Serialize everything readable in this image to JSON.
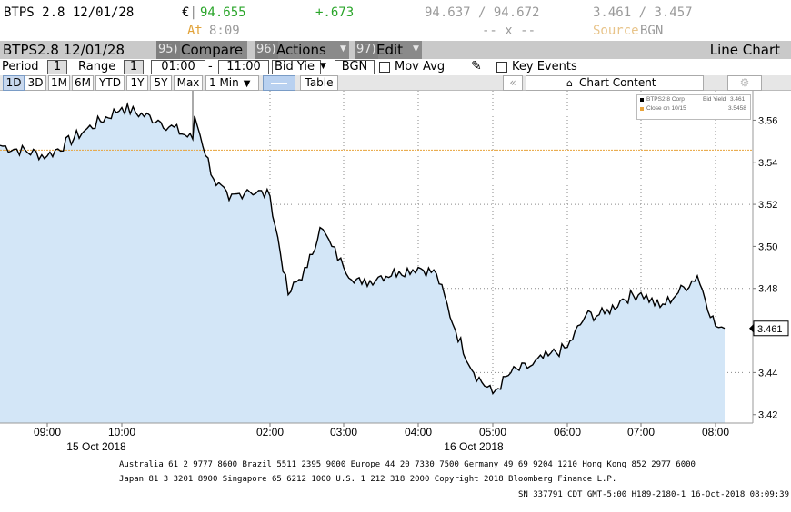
{
  "quote": {
    "ticker": "BTPS 2.8 12/01/28",
    "currency": "€",
    "price": "94.655",
    "change": "+.673",
    "bid_ask": "94.637 / 94.672",
    "yields": "3.461 / 3.457",
    "time_prefix": "At",
    "time": "8:09",
    "dash_x": "-- x --",
    "source_label": "Source",
    "source_value": "BGN",
    "price_color": "#2aa52a",
    "orange": "#e2a33a"
  },
  "titlebar": {
    "security": "BTPS2.8 12/01/28",
    "compare_num": "95)",
    "compare_label": "Compare",
    "actions_num": "96)",
    "actions_label": "Actions",
    "edit_num": "97)",
    "edit_label": "Edit",
    "chart_label": "Line Chart"
  },
  "controls": {
    "period_label": "Period",
    "period_value": "1",
    "range_label": "Range",
    "range_value": "1",
    "time_from": "01:00",
    "time_sep": "-",
    "time_to": "11:00",
    "field": "Bid Yie",
    "source": "BGN",
    "mov_avg": "Mov Avg",
    "key_events": "Key Events"
  },
  "toolbar": {
    "ranges": [
      "1D",
      "3D",
      "1M",
      "6M",
      "YTD",
      "1Y",
      "5Y",
      "Max"
    ],
    "interval": "1 Min",
    "table_label": "Table",
    "chart_content": "Chart Content"
  },
  "legend": {
    "series1": "BTPS2.8 Corp",
    "series1_field": "Bid Yield",
    "series1_value": "3.461",
    "series2": "Close on 10/15",
    "series2_value": "3.5458"
  },
  "chart_data": {
    "type": "area",
    "series": [
      {
        "name": "BTPS2.8 Corp",
        "x": [
          "08:30",
          "09:00",
          "09:30",
          "10:00",
          "10:30",
          "11:00",
          "01:00",
          "01:15",
          "01:30",
          "01:45",
          "02:00",
          "02:15",
          "02:30",
          "02:40",
          "02:50",
          "03:00",
          "03:15",
          "03:30",
          "03:45",
          "04:00",
          "04:15",
          "04:30",
          "04:45",
          "05:00",
          "05:15",
          "05:30",
          "05:45",
          "06:00",
          "06:15",
          "06:30",
          "06:45",
          "07:00",
          "07:15",
          "07:30",
          "07:45",
          "08:00",
          "08:09"
        ],
        "values": [
          3.548,
          3.543,
          3.555,
          3.566,
          3.56,
          3.551,
          3.562,
          3.532,
          3.522,
          3.527,
          3.524,
          3.477,
          3.49,
          3.509,
          3.5,
          3.49,
          3.482,
          3.486,
          3.488,
          3.49,
          3.487,
          3.46,
          3.44,
          3.43,
          3.44,
          3.443,
          3.448,
          3.452,
          3.467,
          3.468,
          3.475,
          3.478,
          3.471,
          3.478,
          3.486,
          3.462,
          3.461
        ]
      }
    ],
    "reference_line": {
      "name": "Close on 10/15",
      "value": 3.5458
    },
    "y_ticks": [
      "3.42",
      "3.44",
      "3.46",
      "3.48",
      "3.50",
      "3.52",
      "3.54",
      "3.56"
    ],
    "ylim": [
      3.416,
      3.574
    ],
    "x_ticks": [
      "09:00",
      "10:00",
      "02:00",
      "03:00",
      "04:00",
      "05:00",
      "06:00",
      "07:00",
      "08:00"
    ],
    "date_labels": [
      "15 Oct 2018",
      "16 Oct 2018"
    ],
    "last_value_label": "3.461",
    "grid": "dotted",
    "fill_color": "#d3e6f7",
    "line_color": "#000000",
    "ref_color": "#e8a33a"
  },
  "footer": {
    "line1": "Australia 61 2 9777 8600 Brazil 5511 2395 9000 Europe 44 20 7330 7500 Germany 49 69 9204 1210 Hong Kong 852 2977 6000",
    "line2": "Japan 81 3 3201 8900     Singapore 65 6212 1000     U.S. 1 212 318 2000          Copyright 2018 Bloomberg Finance L.P.",
    "line3": "SN 337791 CDT  GMT-5:00 H189-2180-1 16-Oct-2018 08:09:39"
  }
}
